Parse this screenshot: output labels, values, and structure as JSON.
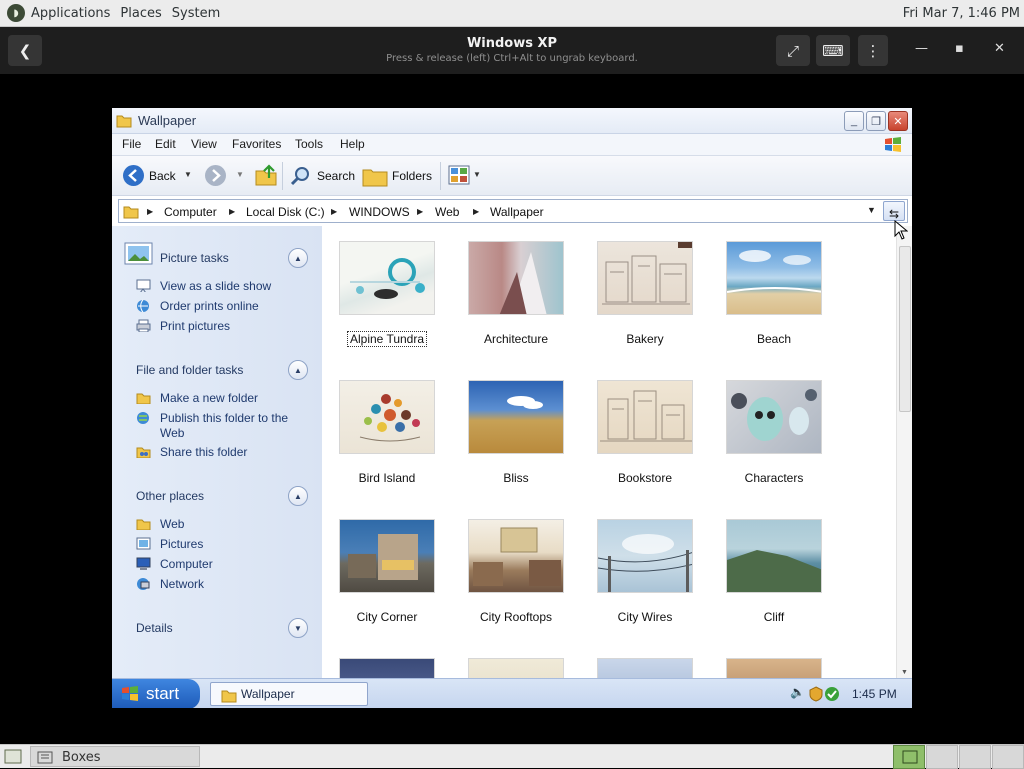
{
  "gnome_panel": {
    "menus": [
      "Applications",
      "Places",
      "System"
    ],
    "clock": "Fri Mar  7,  1:46 PM"
  },
  "boxes_header": {
    "title": "Windows XP",
    "subtitle": "Press & release (left) Ctrl+Alt to ungrab keyboard."
  },
  "window": {
    "title": "Wallpaper"
  },
  "menubar": [
    "File",
    "Edit",
    "View",
    "Favorites",
    "Tools",
    "Help"
  ],
  "toolbar": {
    "back": "Back",
    "search": "Search",
    "folders": "Folders"
  },
  "address": {
    "crumbs": [
      "Computer",
      "Local Disk (C:)",
      "WINDOWS",
      "Web",
      "Wallpaper"
    ]
  },
  "left_panel": {
    "picture_tasks": {
      "title": "Picture tasks",
      "items": [
        "View as a slide show",
        "Order prints online",
        "Print pictures"
      ]
    },
    "file_tasks": {
      "title": "File and folder tasks",
      "items": [
        "Make a new folder",
        "Publish this folder to the Web",
        "Share this folder"
      ]
    },
    "other_places": {
      "title": "Other places",
      "items": [
        "Web",
        "Pictures",
        "Computer",
        "Network"
      ]
    },
    "details": {
      "title": "Details"
    }
  },
  "thumbnails": [
    "Alpine Tundra",
    "Architecture",
    "Bakery",
    "Beach",
    "Bird Island",
    "Bliss",
    "Bookstore",
    "Characters",
    "City Corner",
    "City Rooftops",
    "City Wires",
    "Cliff"
  ],
  "xp_taskbar": {
    "start": "start",
    "window": "Wallpaper",
    "clock": "1:45 PM"
  },
  "gnome_bottom": {
    "label": "Boxes"
  }
}
